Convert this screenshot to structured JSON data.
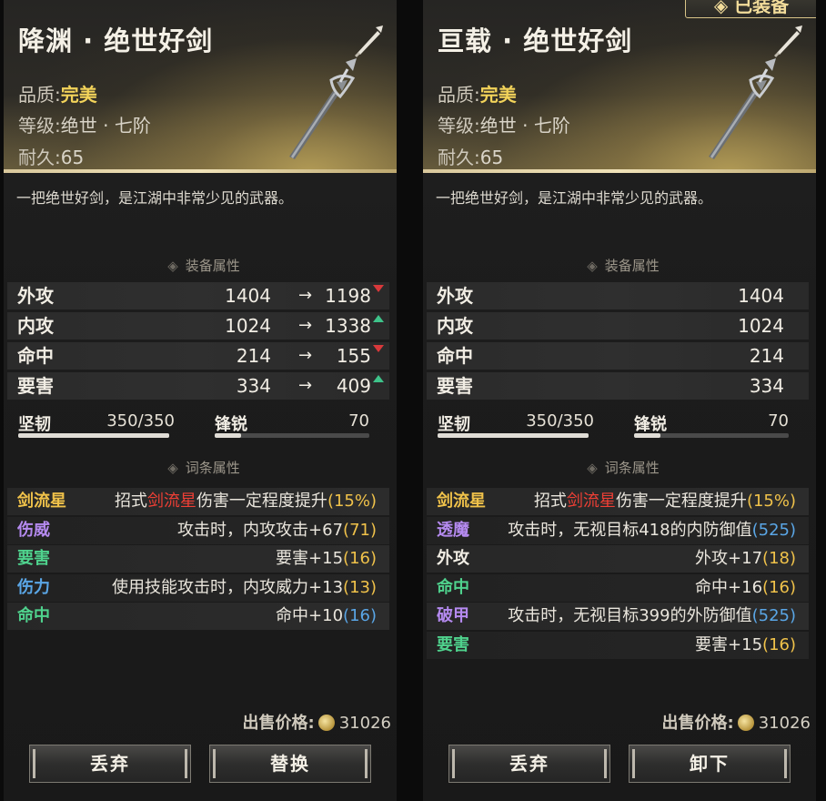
{
  "left": {
    "title": "降渊 · 绝世好剑",
    "quality_label": "品质:",
    "quality_value": "完美",
    "grade_label": "等级:",
    "grade_value": "绝世 · 七阶",
    "durability_label": "耐久:",
    "durability_value": "65",
    "description": "一把绝世好剑，是江湖中非常少见的武器。",
    "stats_title": "装备属性",
    "stats": [
      {
        "name": "外攻",
        "old": "1404",
        "new": "1198",
        "trend": "down"
      },
      {
        "name": "内攻",
        "old": "1024",
        "new": "1338",
        "trend": "up"
      },
      {
        "name": "命中",
        "old": "214",
        "new": "155",
        "trend": "down"
      },
      {
        "name": "要害",
        "old": "334",
        "new": "409",
        "trend": "up"
      }
    ],
    "arrow": "→",
    "toughness_label": "坚韧",
    "toughness_value": "350/350",
    "toughness_fraction": 1.0,
    "sharpness_label": "锋锐",
    "sharpness_value": "70",
    "sharpness_fraction": 0.17,
    "affix_title": "词条属性",
    "affixes": [
      {
        "name": "剑流星",
        "pre": "招式",
        "hl": "剑流星",
        "post": "伤害一定程度提升",
        "bracket": "(15%)",
        "color": "gold",
        "bcolor": "gold"
      },
      {
        "name": "伤威",
        "pre": "",
        "hl": "",
        "post": "攻击时，内攻攻击+67",
        "bracket": "(71)",
        "color": "purple",
        "bcolor": "gold"
      },
      {
        "name": "要害",
        "pre": "",
        "hl": "",
        "post": "要害+15",
        "bracket": "(16)",
        "color": "green",
        "bcolor": "gold"
      },
      {
        "name": "伤力",
        "pre": "",
        "hl": "",
        "post": "使用技能攻击时，内攻威力+13",
        "bracket": "(13)",
        "color": "blue",
        "bcolor": "gold"
      },
      {
        "name": "命中",
        "pre": "",
        "hl": "",
        "post": "命中+10",
        "bracket": "(16)",
        "color": "green",
        "bcolor": "blue"
      }
    ],
    "price_label": "出售价格:",
    "price_value": "31026",
    "btn_discard": "丢弃",
    "btn_action": "替换"
  },
  "right": {
    "equipped_tag": "◈ 已装备",
    "title": "亘载 · 绝世好剑",
    "quality_label": "品质:",
    "quality_value": "完美",
    "grade_label": "等级:",
    "grade_value": "绝世 · 七阶",
    "durability_label": "耐久:",
    "durability_value": "65",
    "description": "一把绝世好剑，是江湖中非常少见的武器。",
    "stats_title": "装备属性",
    "stats": [
      {
        "name": "外攻",
        "value": "1404"
      },
      {
        "name": "内攻",
        "value": "1024"
      },
      {
        "name": "命中",
        "value": "214"
      },
      {
        "name": "要害",
        "value": "334"
      }
    ],
    "toughness_label": "坚韧",
    "toughness_value": "350/350",
    "toughness_fraction": 1.0,
    "sharpness_label": "锋锐",
    "sharpness_value": "70",
    "sharpness_fraction": 0.17,
    "affix_title": "词条属性",
    "affixes": [
      {
        "name": "剑流星",
        "pre": "招式",
        "hl": "剑流星",
        "post": "伤害一定程度提升",
        "bracket": "(15%)",
        "color": "gold",
        "bcolor": "gold"
      },
      {
        "name": "透魔",
        "pre": "",
        "hl": "",
        "post": "攻击时，无视目标418的内防御值",
        "bracket": "(525)",
        "color": "purple",
        "bcolor": "blue"
      },
      {
        "name": "外攻",
        "pre": "",
        "hl": "",
        "post": "外攻+17",
        "bracket": "(18)",
        "color": "white",
        "bcolor": "gold"
      },
      {
        "name": "命中",
        "pre": "",
        "hl": "",
        "post": "命中+16",
        "bracket": "(16)",
        "color": "green",
        "bcolor": "gold"
      },
      {
        "name": "破甲",
        "pre": "",
        "hl": "",
        "post": "攻击时，无视目标399的外防御值",
        "bracket": "(525)",
        "color": "purple",
        "bcolor": "blue"
      },
      {
        "name": "要害",
        "pre": "",
        "hl": "",
        "post": "要害+15",
        "bracket": "(16)",
        "color": "green",
        "bcolor": "gold"
      }
    ],
    "price_label": "出售价格:",
    "price_value": "31026",
    "btn_discard": "丢弃",
    "btn_action": "卸下"
  }
}
